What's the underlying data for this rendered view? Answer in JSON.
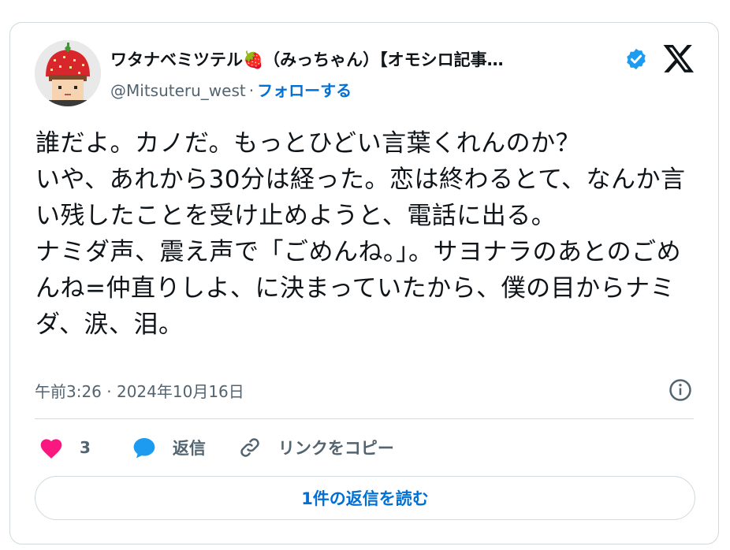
{
  "tweet": {
    "author_name": "ワタナベミツテル🍓（みっちゃん）【オモシロ記事…",
    "handle": "@Mitsuteru_west",
    "separator": "·",
    "follow_label": "フォローする",
    "body": "誰だよ。カノだ。もっとひどい言葉くれんのか？\nいや、あれから30分は経った。恋は終わるとて、なんか言い残したことを受け止めようと、電話に出る。\nナミダ声、震え声で「ごめんね。」。サヨナラのあとのごめんね=仲直りしよ、に決まっていたから、僕の目からナミダ、涙、泪。",
    "timestamp": "午前3:26 · 2024年10月16日",
    "like_count": "3",
    "reply_label": "返信",
    "copy_link_label": "リンクをコピー",
    "read_replies_label": "1件の返信を読む"
  },
  "icons": [
    "avatar",
    "verified-badge-icon",
    "x-logo-icon",
    "info-icon",
    "heart-icon",
    "reply-bubble-icon",
    "link-icon"
  ],
  "colors": {
    "like": "#f91880",
    "link": "#006fd6",
    "verified": "#1d9bf0",
    "muted": "#536471"
  }
}
